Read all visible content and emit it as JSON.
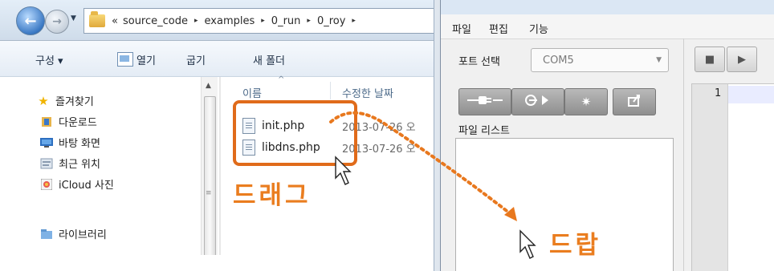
{
  "explorer": {
    "breadcrumb": {
      "overflow": "«",
      "segments": [
        "source_code",
        "examples",
        "0_run",
        "0_roy"
      ],
      "separator": "▸"
    },
    "commands": {
      "organize": "구성 ▾",
      "open": "열기",
      "burn": "굽기",
      "new_folder": "새 폴더"
    },
    "nav": {
      "items": [
        {
          "label": "즐겨찾기",
          "icon": "star-icon"
        },
        {
          "label": "다운로드",
          "icon": "downloads-icon"
        },
        {
          "label": "바탕 화면",
          "icon": "desktop-icon"
        },
        {
          "label": "최근 위치",
          "icon": "recent-places-icon"
        },
        {
          "label": "iCloud 사진",
          "icon": "icloud-photos-icon"
        },
        {
          "label": "라이브러리",
          "icon": "library-icon"
        }
      ]
    },
    "columns": {
      "name": "이름",
      "date_modified": "수정한 날짜"
    },
    "files": [
      {
        "name": "init.php",
        "date": "2013-07-26 오"
      },
      {
        "name": "libdns.php",
        "date": "2013-07-26 오"
      }
    ]
  },
  "tool": {
    "menu": {
      "file": "파일",
      "edit": "편집",
      "function": "기능"
    },
    "port_label": "포트 선택",
    "port_value": "COM5",
    "file_list_label": "파일 리스트",
    "editor": {
      "line_numbers": [
        "1"
      ]
    }
  },
  "annotations": {
    "drag_label": "드래그",
    "drop_label": "드랍",
    "arrow_color": "#e8781e"
  }
}
